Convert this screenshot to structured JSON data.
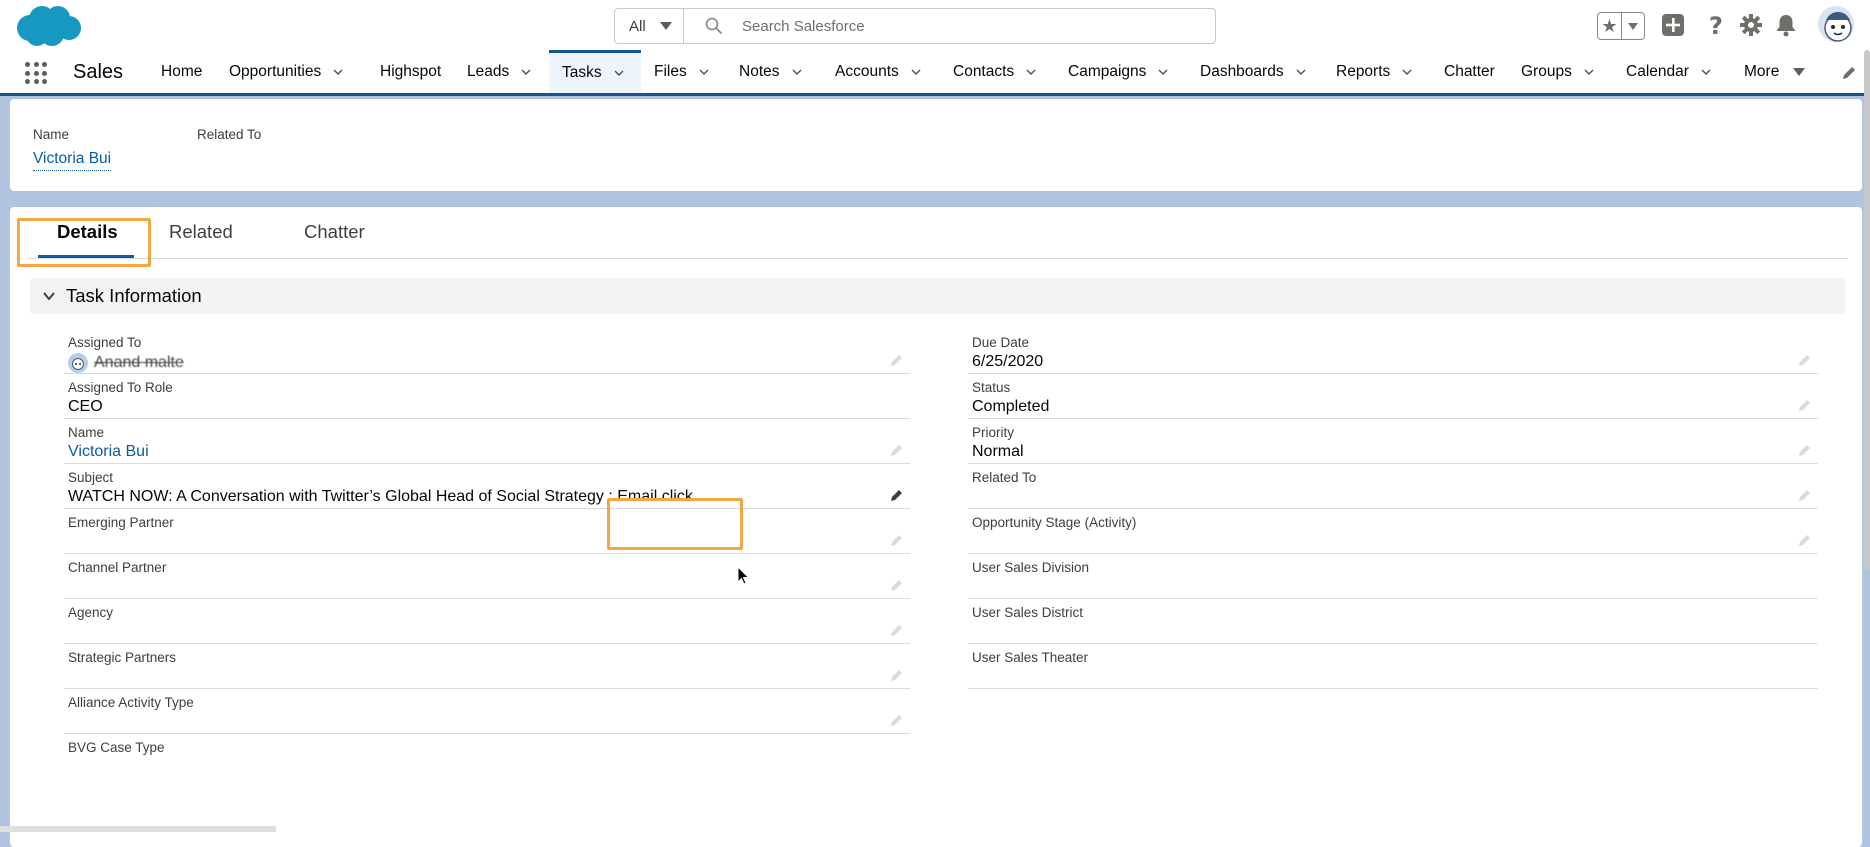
{
  "header": {
    "search_scope": "All",
    "search_placeholder": "Search Salesforce"
  },
  "nav": {
    "app_name": "Sales",
    "items": [
      {
        "label": "Home",
        "has_menu": false
      },
      {
        "label": "Opportunities",
        "has_menu": true
      },
      {
        "label": "Highspot",
        "has_menu": false
      },
      {
        "label": "Leads",
        "has_menu": true
      },
      {
        "label": "Tasks",
        "has_menu": true,
        "active": true
      },
      {
        "label": "Files",
        "has_menu": true
      },
      {
        "label": "Notes",
        "has_menu": true
      },
      {
        "label": "Accounts",
        "has_menu": true
      },
      {
        "label": "Contacts",
        "has_menu": true
      },
      {
        "label": "Campaigns",
        "has_menu": true
      },
      {
        "label": "Dashboards",
        "has_menu": true
      },
      {
        "label": "Reports",
        "has_menu": true
      },
      {
        "label": "Chatter",
        "has_menu": false
      },
      {
        "label": "Groups",
        "has_menu": true
      },
      {
        "label": "Calendar",
        "has_menu": true
      },
      {
        "label": "More",
        "has_menu": true
      }
    ]
  },
  "record_header": {
    "name_label": "Name",
    "name_value": "Victoria Bui",
    "related_label": "Related To"
  },
  "tabs": [
    {
      "label": "Details",
      "active": true
    },
    {
      "label": "Related"
    },
    {
      "label": "Chatter"
    }
  ],
  "section": {
    "title": "Task Information"
  },
  "fields_left": [
    {
      "label": "Assigned To",
      "value": "Anand malte",
      "type": "user"
    },
    {
      "label": "Assigned To Role",
      "value": "CEO"
    },
    {
      "label": "Name",
      "value": "Victoria Bui",
      "type": "link"
    },
    {
      "label": "Subject",
      "value": "WATCH NOW: A Conversation with Twitter’s Global Head of Social Strategy : Email click"
    },
    {
      "label": "Emerging Partner",
      "value": ""
    },
    {
      "label": "Channel Partner",
      "value": ""
    },
    {
      "label": "Agency",
      "value": ""
    },
    {
      "label": "Strategic Partners",
      "value": ""
    },
    {
      "label": "Alliance Activity Type",
      "value": ""
    },
    {
      "label": "BVG Case Type",
      "value": ""
    }
  ],
  "fields_right": [
    {
      "label": "Due Date",
      "value": "6/25/2020"
    },
    {
      "label": "Status",
      "value": "Completed"
    },
    {
      "label": "Priority",
      "value": "Normal"
    },
    {
      "label": "Related To",
      "value": ""
    },
    {
      "label": "Opportunity Stage (Activity)",
      "value": ""
    },
    {
      "label": "User Sales Division",
      "value": ""
    },
    {
      "label": "User Sales District",
      "value": ""
    },
    {
      "label": "User Sales Theater",
      "value": ""
    }
  ],
  "colors": {
    "brand_blue": "#1b5297",
    "link_blue": "#0b5cab",
    "highlight_orange": "#f4a645",
    "cloud_blue": "#1798c1"
  }
}
